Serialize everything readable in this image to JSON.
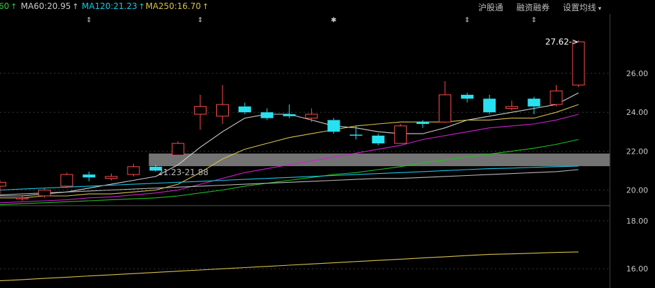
{
  "ma_legend": [
    {
      "label": "60",
      "arrow": "↑",
      "color": "#2ecc40"
    },
    {
      "label": "MA60:20.95",
      "arrow": "↑",
      "color": "#cccccc"
    },
    {
      "label": "MA120:21.23",
      "arrow": "↑",
      "color": "#17c9e8"
    },
    {
      "label": "MA250:16.70",
      "arrow": "↑",
      "color": "#d8c24a"
    }
  ],
  "toolbar": {
    "hgt": "沪股通",
    "rzrq": "融资融券",
    "settings": "设置均线",
    "settings_caret": "▾"
  },
  "event_markers": [
    "⇕",
    "⇕",
    "✱",
    "⇕",
    "⇕"
  ],
  "annotations": {
    "last_price": "27.62",
    "last_price_arrow": "->",
    "range_label": "21.23-21.88"
  },
  "chart_data": {
    "type": "candlestick",
    "y_ticks_upper": [
      "26.00",
      "24.00",
      "22.00",
      "20.00"
    ],
    "y_ticks_lower": [
      "18.00",
      "16.00"
    ],
    "ylim_upper": [
      19.2,
      28.6
    ],
    "ylim_lower": [
      15.2,
      18.6
    ],
    "highlight_band": [
      21.23,
      21.88
    ],
    "candles": [
      {
        "o": 20.2,
        "c": 20.4,
        "h": 20.5,
        "l": 19.8
      },
      {
        "o": 19.6,
        "c": 19.6,
        "h": 19.75,
        "l": 19.45
      },
      {
        "o": 19.7,
        "c": 20.0,
        "h": 20.1,
        "l": 19.6
      },
      {
        "o": 20.2,
        "c": 20.8,
        "h": 20.9,
        "l": 20.1
      },
      {
        "o": 20.8,
        "c": 20.65,
        "h": 20.95,
        "l": 20.45
      },
      {
        "o": 20.6,
        "c": 20.7,
        "h": 20.85,
        "l": 20.5
      },
      {
        "o": 20.8,
        "c": 21.2,
        "h": 21.35,
        "l": 20.7
      },
      {
        "o": 21.2,
        "c": 21.0,
        "h": 21.3,
        "l": 20.95
      },
      {
        "o": 21.8,
        "c": 22.4,
        "h": 22.5,
        "l": 21.8
      },
      {
        "o": 23.9,
        "c": 24.3,
        "h": 24.9,
        "l": 23.1
      },
      {
        "o": 23.8,
        "c": 24.4,
        "h": 25.4,
        "l": 23.4
      },
      {
        "o": 24.3,
        "c": 24.0,
        "h": 24.5,
        "l": 23.9
      },
      {
        "o": 24.0,
        "c": 23.7,
        "h": 24.2,
        "l": 23.6
      },
      {
        "o": 23.9,
        "c": 23.8,
        "h": 24.4,
        "l": 23.7
      },
      {
        "o": 23.7,
        "c": 23.9,
        "h": 24.2,
        "l": 23.5
      },
      {
        "o": 23.6,
        "c": 23.0,
        "h": 23.7,
        "l": 22.9
      },
      {
        "o": 22.85,
        "c": 22.8,
        "h": 23.3,
        "l": 22.6
      },
      {
        "o": 22.8,
        "c": 22.4,
        "h": 22.9,
        "l": 22.3
      },
      {
        "o": 22.4,
        "c": 23.3,
        "h": 23.4,
        "l": 22.4
      },
      {
        "o": 23.5,
        "c": 23.4,
        "h": 23.6,
        "l": 23.2
      },
      {
        "o": 23.5,
        "c": 24.9,
        "h": 25.6,
        "l": 23.5
      },
      {
        "o": 24.9,
        "c": 24.7,
        "h": 25.0,
        "l": 24.5
      },
      {
        "o": 24.7,
        "c": 24.0,
        "h": 24.9,
        "l": 23.9
      },
      {
        "o": 24.2,
        "c": 24.3,
        "h": 24.6,
        "l": 24.1
      },
      {
        "o": 24.7,
        "c": 24.3,
        "h": 24.8,
        "l": 23.9
      },
      {
        "o": 24.4,
        "c": 25.1,
        "h": 25.4,
        "l": 24.3
      },
      {
        "o": 25.4,
        "c": 27.62,
        "h": 27.7,
        "l": 25.3
      }
    ],
    "series": [
      {
        "color": "#cfcfcf",
        "panel": "upper",
        "values": [
          19.7,
          19.7,
          19.8,
          19.9,
          20.1,
          20.3,
          20.5,
          20.7,
          21.3,
          22.2,
          23.0,
          23.7,
          23.9,
          23.9,
          23.6,
          23.3,
          23.2,
          23.0,
          22.9,
          22.9,
          23.2,
          23.6,
          23.8,
          24.0,
          24.2,
          24.4,
          25.0
        ]
      },
      {
        "color": "#d8c24a",
        "panel": "upper",
        "values": [
          19.6,
          19.6,
          19.7,
          19.7,
          19.8,
          19.8,
          19.9,
          20.0,
          20.3,
          20.9,
          21.6,
          22.1,
          22.4,
          22.7,
          22.9,
          23.1,
          23.3,
          23.4,
          23.5,
          23.5,
          23.5,
          23.6,
          23.6,
          23.7,
          23.7,
          24.0,
          24.4
        ]
      },
      {
        "color": "#d020d0",
        "panel": "upper",
        "values": [
          19.35,
          19.4,
          19.45,
          19.5,
          19.6,
          19.65,
          19.75,
          19.85,
          20.0,
          20.3,
          20.6,
          20.9,
          21.1,
          21.3,
          21.5,
          21.7,
          21.9,
          22.1,
          22.3,
          22.6,
          22.8,
          23.0,
          23.2,
          23.3,
          23.4,
          23.6,
          23.9
        ]
      },
      {
        "color": "#20c020",
        "panel": "upper",
        "values": [
          19.25,
          19.3,
          19.35,
          19.4,
          19.45,
          19.5,
          19.55,
          19.6,
          19.7,
          19.85,
          20.0,
          20.2,
          20.35,
          20.5,
          20.65,
          20.8,
          20.9,
          21.05,
          21.2,
          21.4,
          21.55,
          21.7,
          21.85,
          22.0,
          22.15,
          22.35,
          22.6
        ]
      },
      {
        "color": "#17c9e8",
        "panel": "upper",
        "values": [
          20.0,
          20.05,
          20.1,
          20.15,
          20.2,
          20.25,
          20.3,
          20.35,
          20.4,
          20.45,
          20.5,
          20.55,
          20.6,
          20.65,
          20.7,
          20.75,
          20.8,
          20.85,
          20.9,
          20.95,
          21.0,
          21.05,
          21.1,
          21.13,
          21.17,
          21.2,
          21.23
        ]
      },
      {
        "color": "#b8b8b8",
        "panel": "upper",
        "values": [
          19.75,
          19.8,
          19.85,
          19.9,
          19.95,
          20.0,
          20.05,
          20.1,
          20.15,
          20.2,
          20.25,
          20.3,
          20.35,
          20.4,
          20.45,
          20.5,
          20.55,
          20.6,
          20.6,
          20.65,
          20.7,
          20.75,
          20.8,
          20.85,
          20.9,
          20.95,
          21.05
        ]
      },
      {
        "color": "#d8c24a",
        "panel": "lower",
        "values": [
          15.5,
          15.55,
          15.6,
          15.65,
          15.7,
          15.75,
          15.8,
          15.85,
          15.9,
          15.95,
          16.0,
          16.05,
          16.1,
          16.15,
          16.2,
          16.25,
          16.3,
          16.35,
          16.4,
          16.45,
          16.5,
          16.55,
          16.6,
          16.62,
          16.65,
          16.68,
          16.7
        ]
      }
    ]
  }
}
